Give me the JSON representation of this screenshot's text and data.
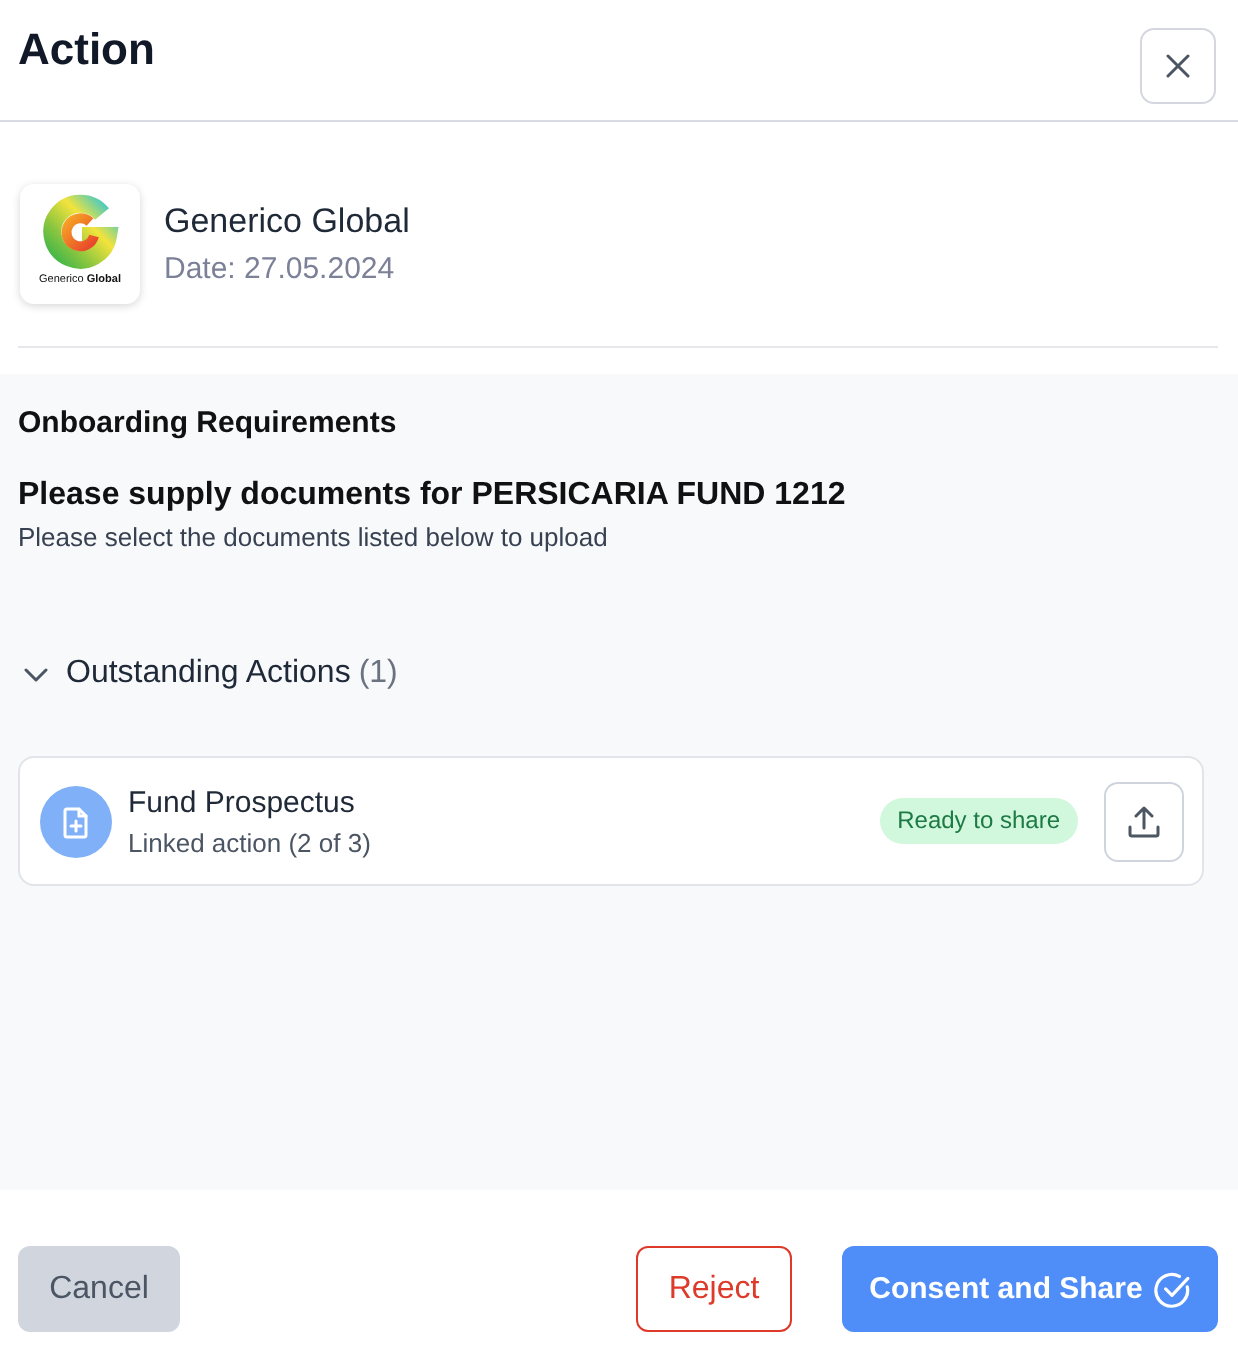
{
  "header": {
    "title": "Action"
  },
  "company": {
    "logo_text": "Generico **Global**",
    "name": "Generico Global",
    "date": "Date: 27.05.2024"
  },
  "requirements": {
    "heading": "Onboarding Requirements",
    "title": "Please supply documents for PERSICARIA FUND 1212",
    "subtitle": "Please select the documents listed below to upload"
  },
  "outstanding": {
    "label": "Outstanding Actions",
    "count": "(1)",
    "expanded": true,
    "items": [
      {
        "title": "Fund Prospectus",
        "subtitle": "Linked action (2 of 3)",
        "status": "Ready to share"
      }
    ]
  },
  "footer": {
    "buttons": [
      {
        "label": "Cancel",
        "kind": "secondary"
      },
      {
        "label": "Reject",
        "kind": "danger"
      },
      {
        "label": "Consent and Share",
        "kind": "primary"
      }
    ]
  }
}
